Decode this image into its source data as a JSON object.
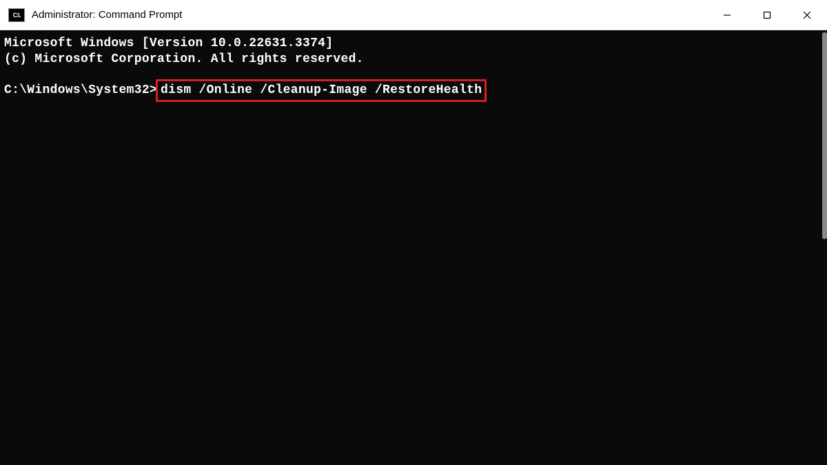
{
  "titlebar": {
    "icon_label": "C:\\.",
    "title": "Administrator: Command Prompt"
  },
  "terminal": {
    "line1": "Microsoft Windows [Version 10.0.22631.3374]",
    "line2": "(c) Microsoft Corporation. All rights reserved.",
    "prompt": "C:\\Windows\\System32>",
    "command": "dism /Online /Cleanup-Image /RestoreHealth"
  }
}
